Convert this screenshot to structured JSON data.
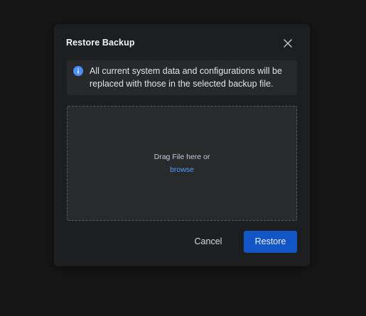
{
  "dialog": {
    "title": "Restore Backup",
    "close_icon": "close-icon",
    "info": {
      "icon": "info-icon",
      "message": "All current system data and configurations will be replaced with those in the selected backup file."
    },
    "drop_zone": {
      "prompt": "Drag File here or",
      "browse_label": "browse"
    },
    "footer": {
      "cancel_label": "Cancel",
      "restore_label": "Restore"
    }
  },
  "colors": {
    "backdrop": "#161616",
    "modal_background": "#1d1e20",
    "info_background": "#26282b",
    "info_icon": "#4c8ef7",
    "link": "#5a9cf8",
    "primary_button": "#1255c7"
  }
}
